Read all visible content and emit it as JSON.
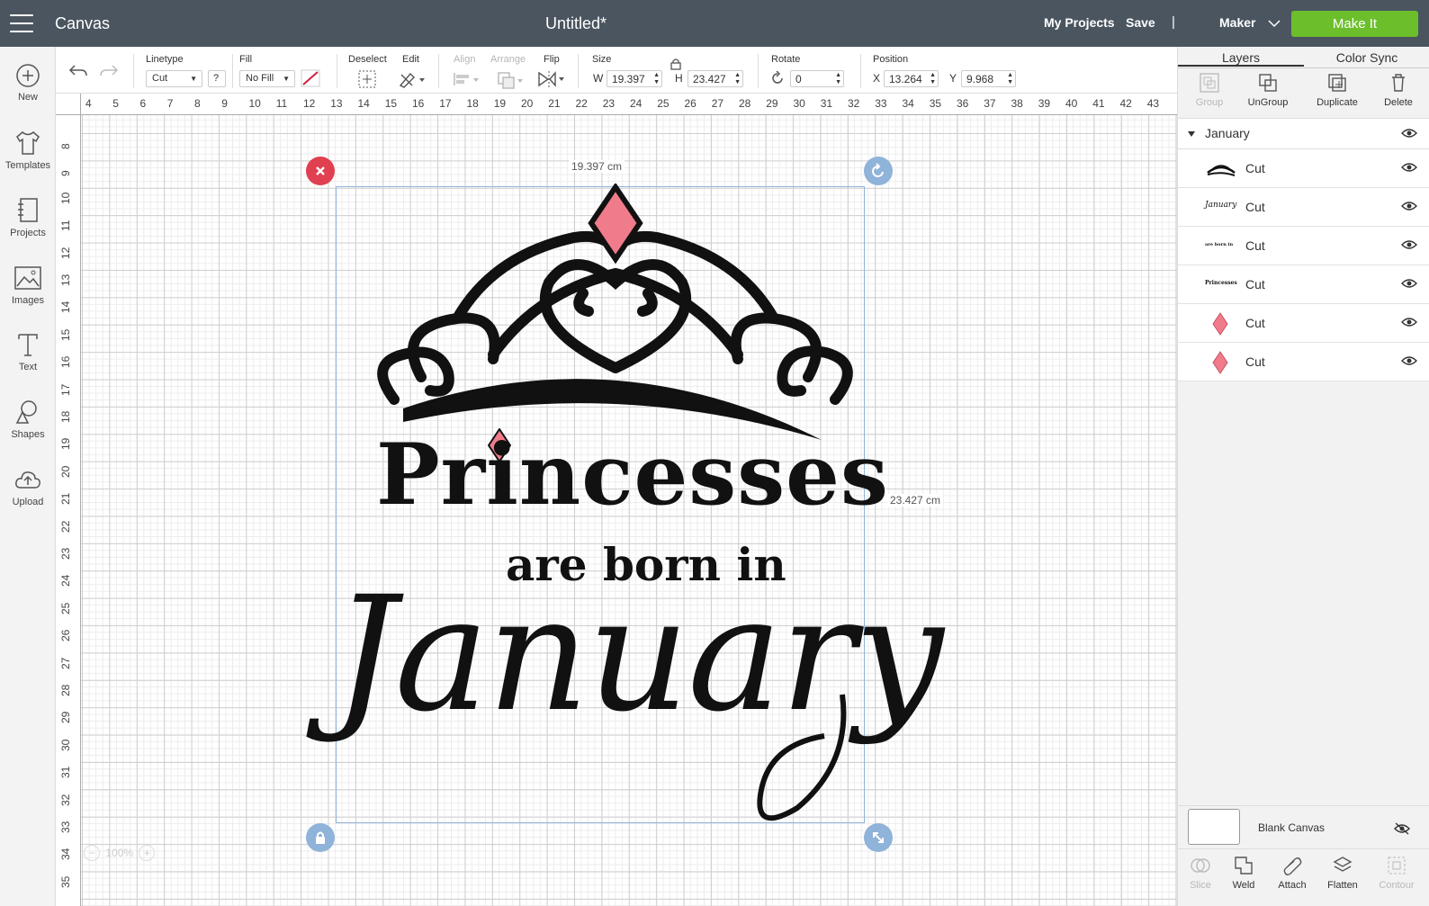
{
  "header": {
    "app_name": "Canvas",
    "doc_title": "Untitled*",
    "my_projects": "My Projects",
    "save": "Save",
    "separator": "|",
    "machine": "Maker",
    "make_it": "Make It"
  },
  "sidebar": {
    "items": [
      {
        "label": "New",
        "icon": "plus-circle-icon"
      },
      {
        "label": "Templates",
        "icon": "tshirt-icon"
      },
      {
        "label": "Projects",
        "icon": "notebook-icon"
      },
      {
        "label": "Images",
        "icon": "image-icon"
      },
      {
        "label": "Text",
        "icon": "text-icon"
      },
      {
        "label": "Shapes",
        "icon": "shapes-icon"
      },
      {
        "label": "Upload",
        "icon": "cloud-upload-icon"
      }
    ]
  },
  "toolbar": {
    "linetype_label": "Linetype",
    "linetype_value": "Cut",
    "help": "?",
    "fill_label": "Fill",
    "fill_value": "No Fill",
    "deselect_label": "Deselect",
    "edit_label": "Edit",
    "align_label": "Align",
    "arrange_label": "Arrange",
    "flip_label": "Flip",
    "size_label": "Size",
    "w_label": "W",
    "w_value": "19.397",
    "h_label": "H",
    "h_value": "23.427",
    "rotate_label": "Rotate",
    "rotate_value": "0",
    "position_label": "Position",
    "x_label": "X",
    "x_value": "13.264",
    "y_label": "Y",
    "y_value": "9.968"
  },
  "rulers": {
    "top": [
      "4",
      "5",
      "6",
      "7",
      "8",
      "9",
      "10",
      "11",
      "12",
      "13",
      "14",
      "15",
      "16",
      "17",
      "18",
      "19",
      "20",
      "21",
      "22",
      "23",
      "24",
      "25",
      "26",
      "27",
      "28",
      "29",
      "30",
      "31",
      "32",
      "33",
      "34",
      "35",
      "36",
      "37",
      "38",
      "39",
      "40",
      "41",
      "42",
      "43"
    ],
    "left": [
      "8",
      "9",
      "10",
      "11",
      "12",
      "13",
      "14",
      "15",
      "16",
      "17",
      "18",
      "19",
      "20",
      "21",
      "22",
      "23",
      "24",
      "25",
      "26",
      "27",
      "28",
      "29",
      "30",
      "31",
      "32",
      "33",
      "34",
      "35"
    ]
  },
  "canvas": {
    "width_label": "19.397 cm",
    "height_label": "23.427 cm",
    "design": {
      "line1": "Princesses",
      "line2": "are born in",
      "line3": "January"
    },
    "zoom": "100%"
  },
  "panel": {
    "tabs": [
      "Layers",
      "Color Sync"
    ],
    "tools": [
      {
        "label": "Group",
        "enabled": false
      },
      {
        "label": "UnGroup",
        "enabled": true
      },
      {
        "label": "Duplicate",
        "enabled": true
      },
      {
        "label": "Delete",
        "enabled": true
      }
    ],
    "group_name": "January",
    "layers": [
      {
        "label": "Cut",
        "thumb": "tiara"
      },
      {
        "label": "Cut",
        "thumb": "January"
      },
      {
        "label": "Cut",
        "thumb": "are born in"
      },
      {
        "label": "Cut",
        "thumb": "Princesses"
      },
      {
        "label": "Cut",
        "thumb": "diamond"
      },
      {
        "label": "Cut",
        "thumb": "diamond"
      }
    ],
    "blank_canvas": "Blank Canvas",
    "bottom_tools": [
      {
        "label": "Slice",
        "enabled": false
      },
      {
        "label": "Weld",
        "enabled": true
      },
      {
        "label": "Attach",
        "enabled": true
      },
      {
        "label": "Flatten",
        "enabled": true
      },
      {
        "label": "Contour",
        "enabled": false
      }
    ]
  },
  "colors": {
    "topbar": "#4a5560",
    "make_it": "#6cbf2b",
    "gem": "#f07b8a",
    "selection": "#8fb3d9",
    "delete_handle": "#e04050"
  }
}
